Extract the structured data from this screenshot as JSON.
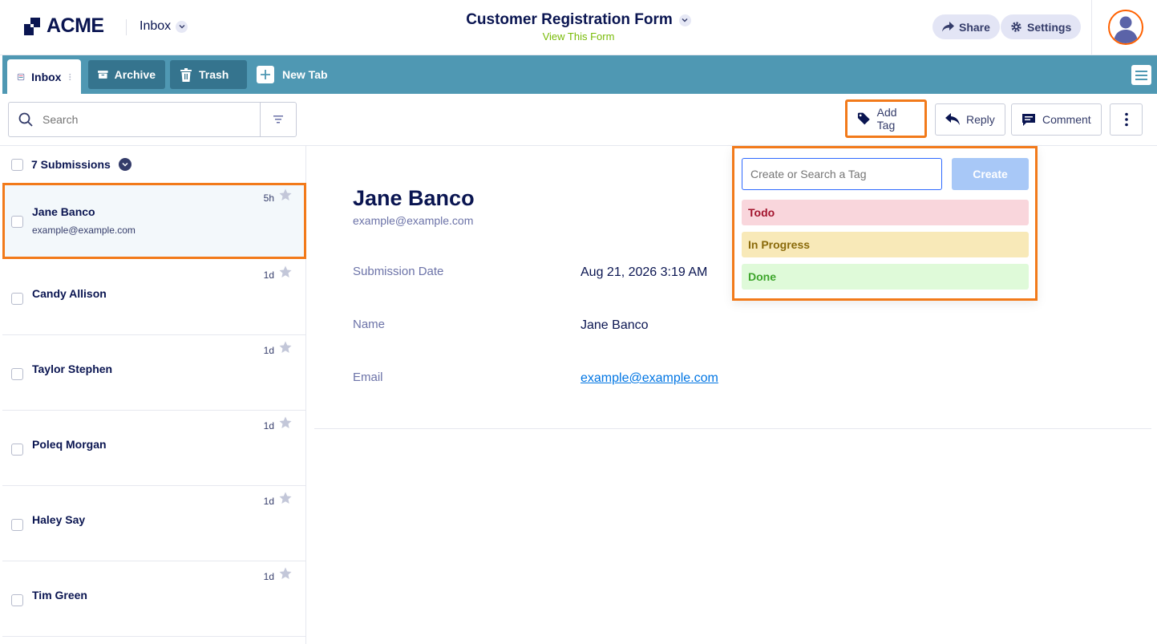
{
  "header": {
    "logo_text": "ACME",
    "inbox_label": "Inbox",
    "form_title": "Customer Registration Form",
    "view_form_label": "View This Form",
    "share_label": "Share",
    "settings_label": "Settings"
  },
  "tabs": {
    "inbox": "Inbox",
    "archive": "Archive",
    "trash": "Trash",
    "new_tab": "New Tab"
  },
  "toolbar": {
    "search_placeholder": "Search",
    "add_tag_label": "Add Tag",
    "reply_label": "Reply",
    "comment_label": "Comment"
  },
  "submissions": {
    "count_label": "7 Submissions",
    "items": [
      {
        "name": "Jane Banco",
        "email": "example@example.com",
        "age": "5h"
      },
      {
        "name": "Candy Allison",
        "email": "",
        "age": "1d"
      },
      {
        "name": "Taylor Stephen",
        "email": "",
        "age": "1d"
      },
      {
        "name": "Poleq Morgan",
        "email": "",
        "age": "1d"
      },
      {
        "name": "Haley Say",
        "email": "",
        "age": "1d"
      },
      {
        "name": "Tim Green",
        "email": "",
        "age": "1d"
      }
    ]
  },
  "detail": {
    "name": "Jane Banco",
    "email": "example@example.com",
    "fields": [
      {
        "label": "Submission Date",
        "value": "Aug 21, 2026 3:19 AM"
      },
      {
        "label": "Name",
        "value": "Jane Banco"
      },
      {
        "label": "Email",
        "value": "example@example.com"
      }
    ]
  },
  "tag_popover": {
    "input_placeholder": "Create or Search a Tag",
    "create_label": "Create",
    "tags": [
      {
        "label": "Todo",
        "bg": "#f9d6dc",
        "color": "#a3152e"
      },
      {
        "label": "In Progress",
        "bg": "#f8e9b8",
        "color": "#8a6a0a"
      },
      {
        "label": "Done",
        "bg": "#dffad9",
        "color": "#3ea52c"
      }
    ]
  },
  "colors": {
    "accent": "#4f98b3",
    "highlight": "#f27a1a",
    "navy": "#0a1551"
  }
}
